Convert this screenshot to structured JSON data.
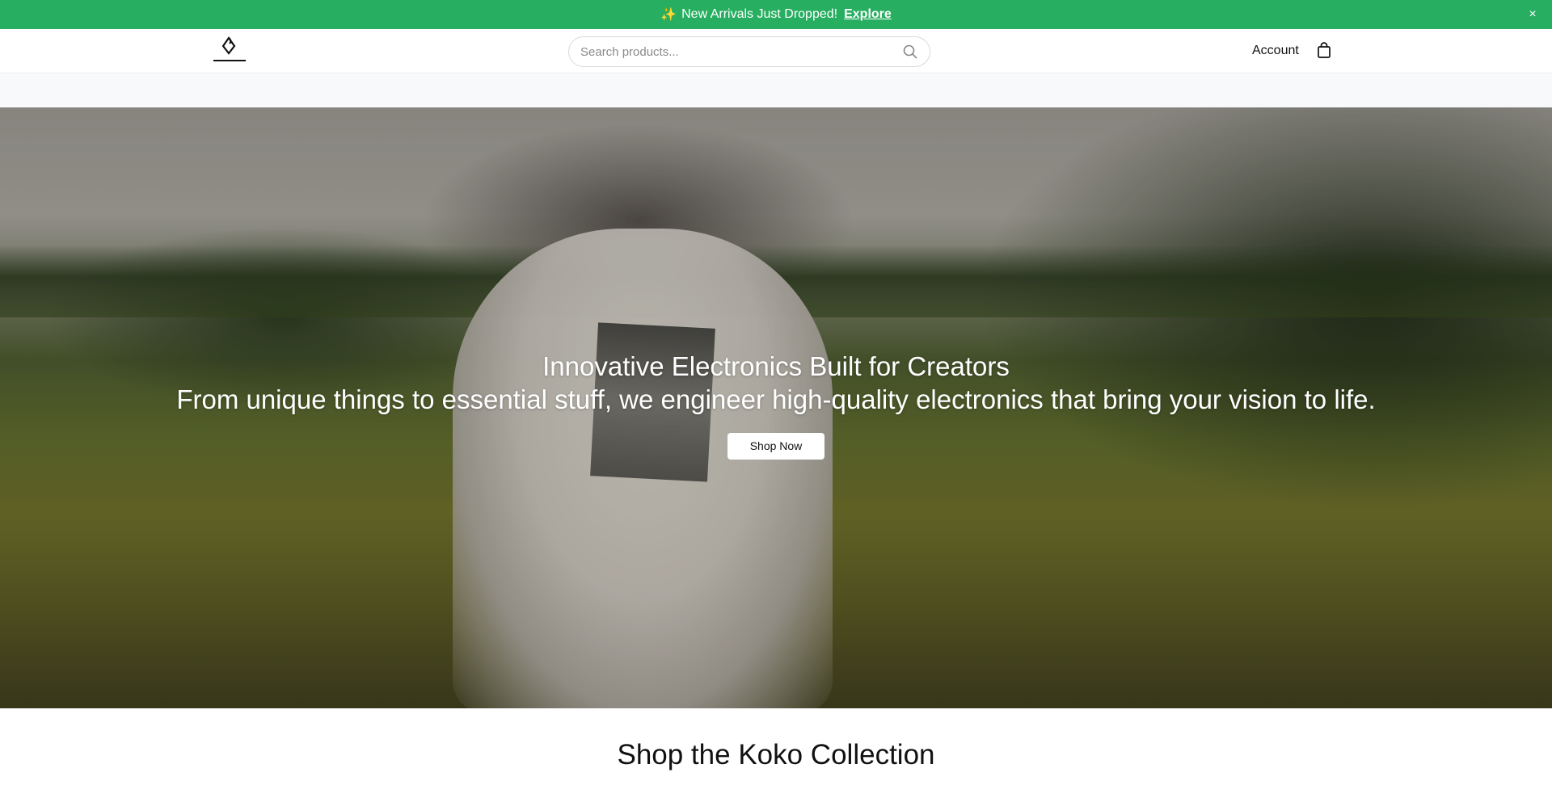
{
  "announcement": {
    "spark_icon": "✨",
    "text": "New Arrivals Just Dropped!",
    "link_label": "Explore",
    "close_icon": "×",
    "background": "#27ae60"
  },
  "header": {
    "logo_icon": "brand-logo-icon",
    "search": {
      "placeholder": "Search products..."
    },
    "account_label": "Account",
    "bag_icon": "shopping-bag-icon"
  },
  "hero": {
    "title": "Innovative Electronics Built for Creators",
    "subtitle": "From unique things to essential stuff, we engineer high-quality electronics that bring your vision to life.",
    "button_label": "Shop Now"
  },
  "collection": {
    "heading": "Shop the Koko Collection"
  }
}
